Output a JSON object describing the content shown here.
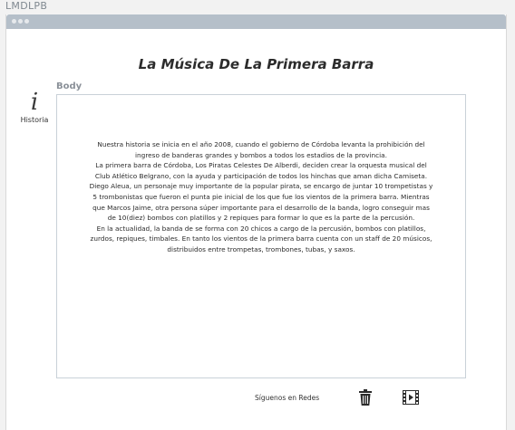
{
  "app": {
    "title": "LMDLPB"
  },
  "page": {
    "title": "La Música De La Primera Barra"
  },
  "side": {
    "icon": "info-icon",
    "label": "Historia"
  },
  "body": {
    "label": "Body",
    "lines": [
      "Nuestra historia se inicia en el año 2008, cuando el gobierno de Córdoba levanta la prohibición del",
      "ingreso de banderas grandes y bombos a todos los estadios de la provincia.",
      "La primera barra de Córdoba, Los Piratas Celestes De Alberdi, deciden crear la orquesta musical del",
      "Club Atlético Belgrano, con la ayuda y participación de todos los hinchas que aman dicha Camiseta.",
      "Diego Aleua, un personaje muy importante de la popular pirata, se encargo de juntar 10 trompetistas y",
      "5 trombonistas que fueron el punta pie inicial de los que fue los vientos de la primera barra. Mientras",
      "que Marcos Jaime, otra persona súper importante para el desarrollo de la banda, logro conseguir mas",
      "de 10(diez) bombos con platillos y 2 repiques para formar lo que es la parte de la percusión.",
      "En la actualidad, la banda de se forma con 20 chicos a cargo de la percusión, bombos con platillos,",
      "zurdos, repiques, timbales. En tanto los vientos de la primera barra cuenta con un  staff de 20 músicos,",
      "distribuidos entre trompetas, trombones, tubas, y saxos."
    ]
  },
  "footer": {
    "social_label": "Síguenos en Redes",
    "icons": [
      "trash-icon",
      "video-icon"
    ]
  }
}
